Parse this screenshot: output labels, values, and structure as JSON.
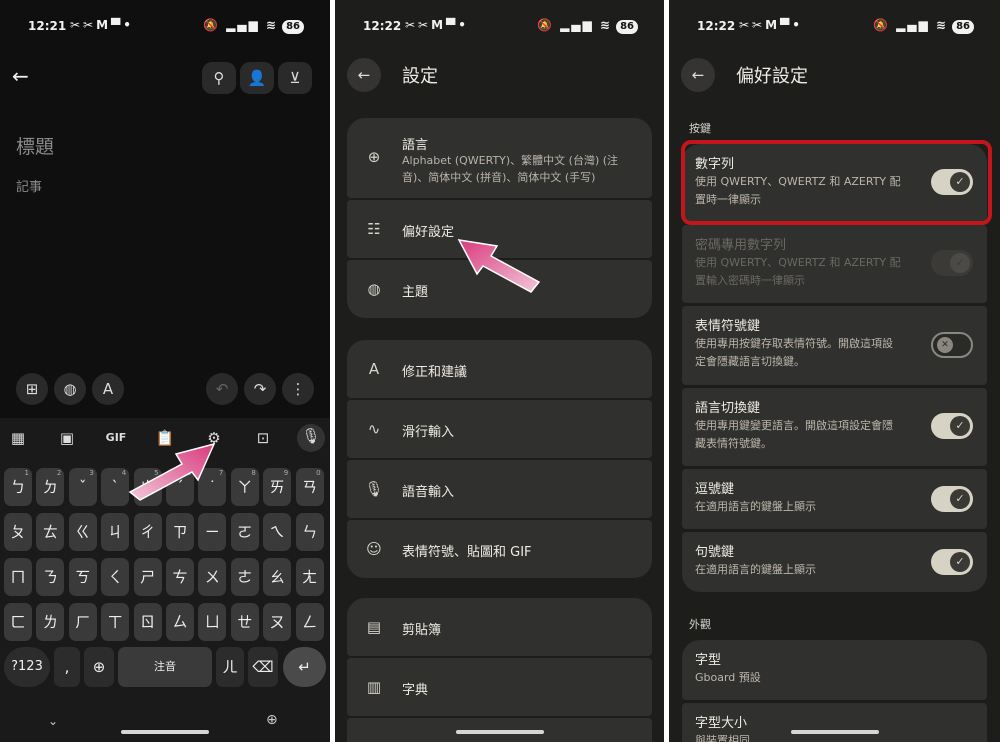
{
  "screen1": {
    "status": {
      "time": "12:21",
      "battery": "86"
    },
    "note_title_placeholder": "標題",
    "note_body_placeholder": "記事",
    "toolbar": {
      "gif": "GIF"
    },
    "keys": {
      "row1": [
        "ㄅ",
        "ㄉ",
        "ˇ",
        "ˋ",
        "ㄓ",
        "ˊ",
        "˙",
        "ㄚ",
        "ㄞ",
        "ㄢ"
      ],
      "row2": [
        "ㄆ",
        "ㄊ",
        "ㄍ",
        "ㄐ",
        "ㄔ",
        "ㄗ",
        "ㄧ",
        "ㄛ",
        "ㄟ",
        "ㄣ"
      ],
      "row3": [
        "ㄇ",
        "ㄋ",
        "ㄎ",
        "ㄑ",
        "ㄕ",
        "ㄘ",
        "ㄨ",
        "ㄜ",
        "ㄠ",
        "ㄤ"
      ],
      "row4": [
        "ㄈ",
        "ㄌ",
        "ㄏ",
        "ㄒ",
        "ㄖ",
        "ㄙ",
        "ㄩ",
        "ㄝ",
        "ㄡ",
        "ㄥ"
      ],
      "hints": [
        "1",
        "2",
        "3",
        "4",
        "5",
        "6",
        "7",
        "8",
        "9",
        "0"
      ],
      "numbers_key": "?123",
      "punct_key": ",",
      "space_key": "注音",
      "er_key": "ㄦ"
    }
  },
  "screen2": {
    "status": {
      "time": "12:22",
      "battery": "86"
    },
    "title": "設定",
    "groups": [
      [
        {
          "icon": "globe-icon",
          "label": "語言",
          "sub": "Alphabet (QWERTY)、繁體中文 (台灣) (注音)、简体中文 (拼音)、简体中文 (手写)"
        },
        {
          "icon": "tune-icon",
          "label": "偏好設定"
        },
        {
          "icon": "palette-icon",
          "label": "主題"
        }
      ],
      [
        {
          "icon": "spellcheck-icon",
          "label": "修正和建議"
        },
        {
          "icon": "gesture-icon",
          "label": "滑行輸入"
        },
        {
          "icon": "mic-icon",
          "label": "語音輸入"
        },
        {
          "icon": "emoji-icon",
          "label": "表情符號、貼圖和 GIF"
        }
      ],
      [
        {
          "icon": "clipboard-icon",
          "label": "剪貼簿"
        },
        {
          "icon": "book-icon",
          "label": "字典"
        }
      ]
    ]
  },
  "screen3": {
    "status": {
      "time": "12:22",
      "battery": "86"
    },
    "title": "偏好設定",
    "section_keys": "按鍵",
    "section_appearance": "外觀",
    "prefs": [
      {
        "title": "數字列",
        "desc": "使用 QWERTY、QWERTZ 和 AZERTY 配置時一律顯示",
        "state": "on"
      },
      {
        "title": "密碼專用數字列",
        "desc": "使用 QWERTY、QWERTZ 和 AZERTY 配置輸入密碼時一律顯示",
        "state": "disabled"
      },
      {
        "title": "表情符號鍵",
        "desc": "使用專用按鍵存取表情符號。開啟這項設定會隱藏語言切換鍵。",
        "state": "off"
      },
      {
        "title": "語言切換鍵",
        "desc": "使用專用鍵變更語言。開啟這項設定會隱藏表情符號鍵。",
        "state": "on"
      },
      {
        "title": "逗號鍵",
        "desc": "在適用語言的鍵盤上顯示",
        "state": "on"
      },
      {
        "title": "句號鍵",
        "desc": "在適用語言的鍵盤上顯示",
        "state": "on"
      }
    ],
    "appearance": [
      {
        "title": "字型",
        "desc": "Gboard 預設"
      },
      {
        "title": "字型大小",
        "desc": "與裝置相同"
      }
    ]
  },
  "colors": {
    "highlight_arrow": "#e0508a",
    "red_outline": "#c4141c"
  }
}
